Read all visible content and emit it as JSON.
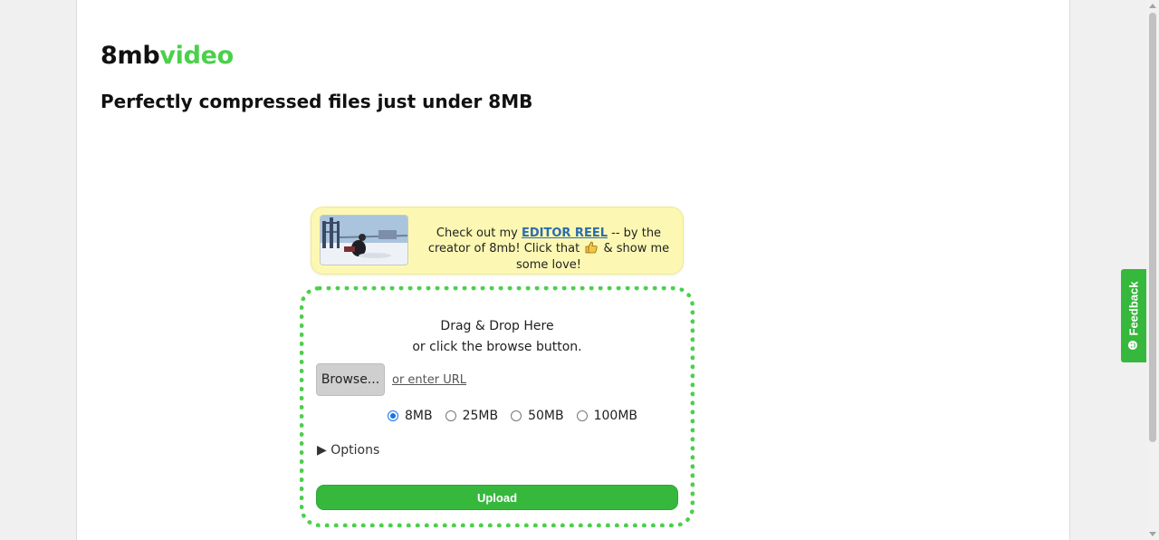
{
  "brand": {
    "part1": "8mb",
    "part2": "video",
    "accent_color": "#4bd04b"
  },
  "tagline": "Perfectly compressed files just under 8MB",
  "promo": {
    "thumbnail_icon": "video-thumbnail",
    "text_before": "Check out my ",
    "link_text": "EDITOR REEL",
    "text_middle": " -- by the creator of 8mb! Click that ",
    "emoji_icon": "thumbs-up-icon",
    "text_after": " & show me some love!"
  },
  "uploader": {
    "drop_line1": "Drag & Drop Here",
    "drop_line2": "or click the browse button.",
    "browse_label": "Browse...",
    "url_link": "or enter URL",
    "sizes": [
      {
        "label": "8MB",
        "selected": true
      },
      {
        "label": "25MB",
        "selected": false
      },
      {
        "label": "50MB",
        "selected": false
      },
      {
        "label": "100MB",
        "selected": false
      }
    ],
    "options_label": "▶ Options",
    "upload_label": "Upload",
    "button_color": "#36b83d"
  },
  "feedback": {
    "label": "Feedback",
    "icon": "smile-icon"
  }
}
